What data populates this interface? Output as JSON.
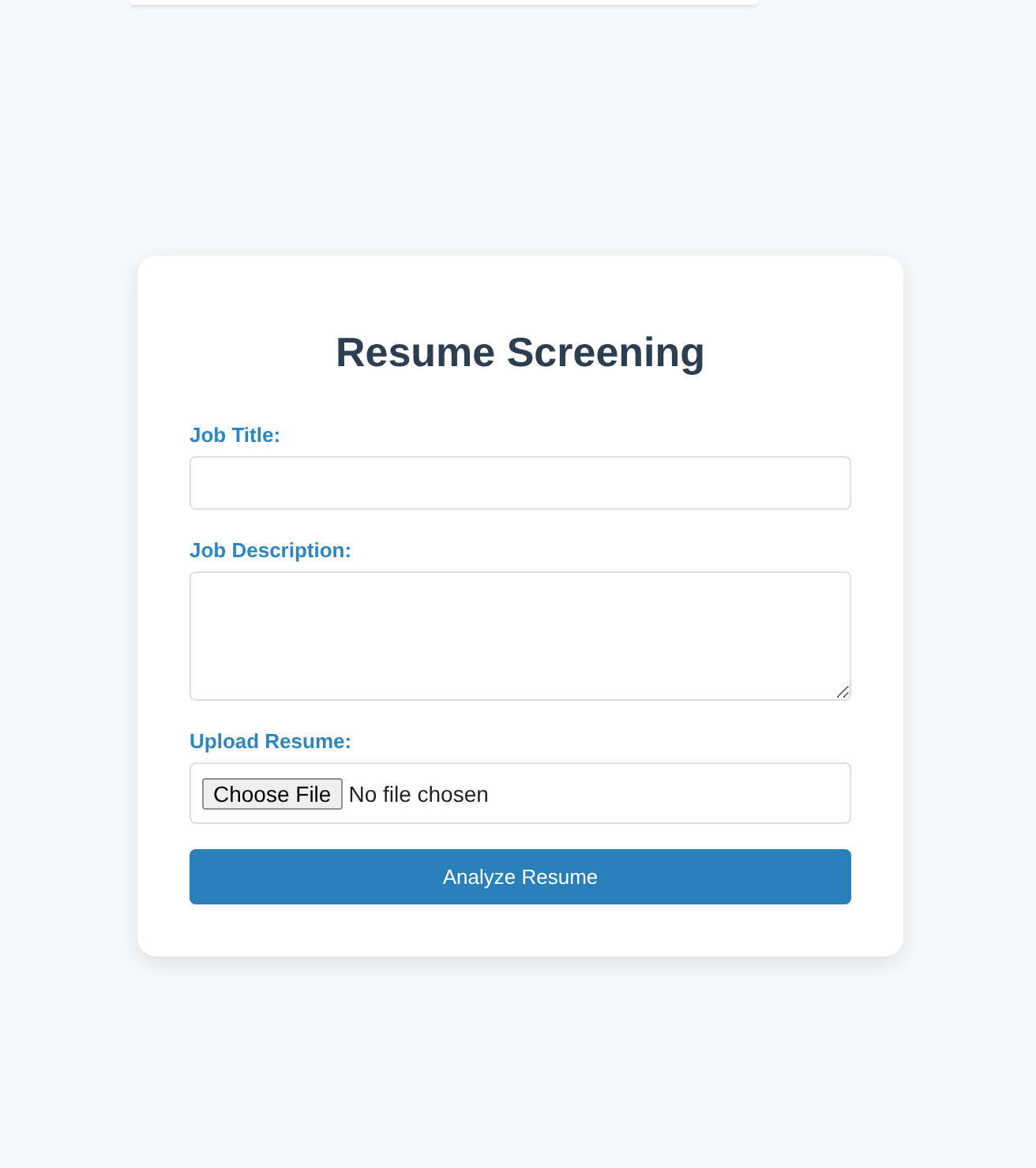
{
  "form": {
    "title": "Resume Screening",
    "fields": [
      {
        "kind": "text",
        "label": "Job Title:"
      },
      {
        "kind": "textarea",
        "label": "Job Description:"
      },
      {
        "kind": "file",
        "label": "Upload Resume:",
        "button": "Choose File",
        "status": "No file chosen"
      }
    ],
    "submit": "Analyze Resume"
  }
}
